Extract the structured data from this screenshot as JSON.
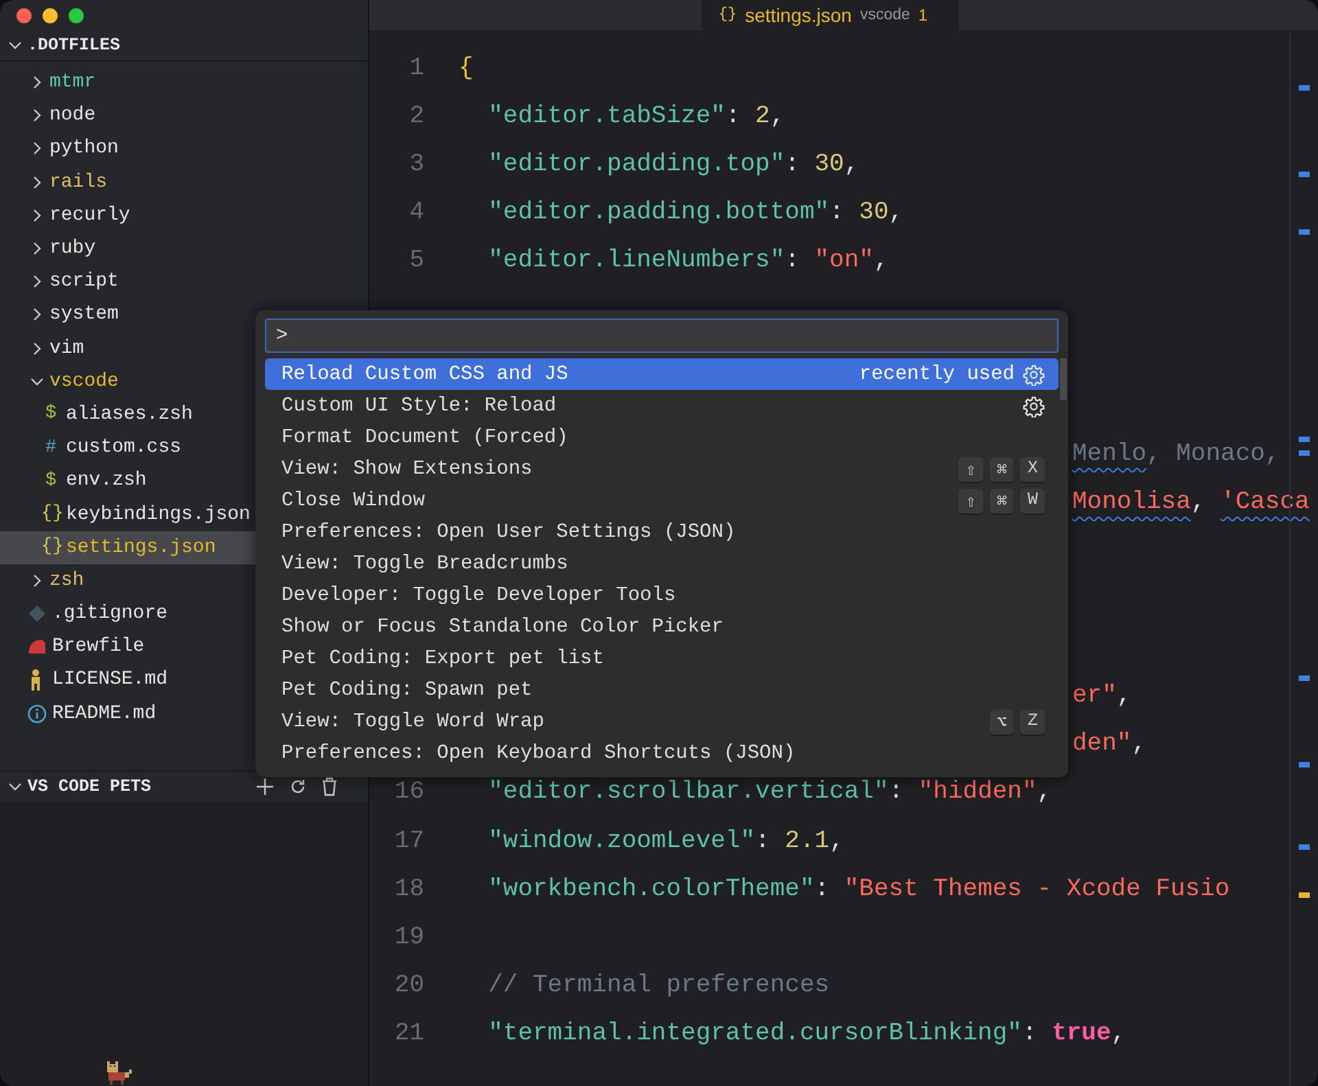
{
  "explorer": {
    "title": ".DOTFILES",
    "expanded": true,
    "items": [
      {
        "label": "mtmr",
        "kind": "folder",
        "expanded": false,
        "color": "#5fcfa2",
        "selected": false
      },
      {
        "label": "node",
        "kind": "folder",
        "expanded": false,
        "color": "#e6e6e6",
        "selected": false
      },
      {
        "label": "python",
        "kind": "folder",
        "expanded": false,
        "color": "#e6e6e6",
        "selected": false
      },
      {
        "label": "rails",
        "kind": "folder",
        "expanded": false,
        "color": "#e2bb6c",
        "selected": false
      },
      {
        "label": "recurly",
        "kind": "folder",
        "expanded": false,
        "color": "#e6e6e6",
        "selected": false
      },
      {
        "label": "ruby",
        "kind": "folder",
        "expanded": false,
        "color": "#e6e6e6",
        "selected": false
      },
      {
        "label": "script",
        "kind": "folder",
        "expanded": false,
        "color": "#e6e6e6",
        "selected": false
      },
      {
        "label": "system",
        "kind": "folder",
        "expanded": false,
        "color": "#e6e6e6",
        "selected": false
      },
      {
        "label": "vim",
        "kind": "folder",
        "expanded": false,
        "color": "#e6e6e6",
        "selected": false
      },
      {
        "label": "vscode",
        "kind": "folder",
        "expanded": true,
        "color": "#e5b92c",
        "selected": false,
        "children": [
          {
            "label": "aliases.zsh",
            "kind": "shell",
            "glyph": "$",
            "color": "#e6e6e6",
            "selected": false
          },
          {
            "label": "custom.css",
            "kind": "css",
            "glyph": "#",
            "color": "#e6e6e6",
            "selected": false
          },
          {
            "label": "env.zsh",
            "kind": "shell",
            "glyph": "$",
            "color": "#e6e6e6",
            "selected": false
          },
          {
            "label": "keybindings.json",
            "kind": "json",
            "glyph": "{}",
            "color": "#e6e6e6",
            "selected": false
          },
          {
            "label": "settings.json",
            "kind": "json",
            "glyph": "{}",
            "color": "#e5b92c",
            "selected": true
          }
        ]
      },
      {
        "label": "zsh",
        "kind": "folder",
        "expanded": false,
        "color": "#e2bb6c",
        "selected": false
      },
      {
        "label": ".gitignore",
        "kind": "diamond",
        "color": "#e6e6e6",
        "selected": false
      },
      {
        "label": "Brewfile",
        "kind": "blob",
        "color": "#e6e6e6",
        "selected": false
      },
      {
        "label": "LICENSE.md",
        "kind": "figure",
        "color": "#e6e6e6",
        "selected": false
      },
      {
        "label": "README.md",
        "kind": "info",
        "color": "#e6e6e6",
        "selected": false
      }
    ]
  },
  "pets_panel": {
    "title": "VS CODE PETS",
    "expanded": true
  },
  "tab": {
    "icon": "{}",
    "label": "settings.json",
    "folder": "vscode",
    "problems": "1"
  },
  "editor_lines": [
    {
      "kind": "line",
      "number": "1",
      "tokens": [
        {
          "text": "{",
          "kind": "brace"
        }
      ]
    },
    {
      "kind": "line",
      "number": "2",
      "tokens": [
        {
          "text": "  \"editor.tabSize\"",
          "kind": "key"
        },
        {
          "text": ": ",
          "kind": "punct"
        },
        {
          "text": "2",
          "kind": "number"
        },
        {
          "text": ",",
          "kind": "punct"
        }
      ]
    },
    {
      "kind": "line",
      "number": "3",
      "tokens": [
        {
          "text": "  \"editor.padding.top\"",
          "kind": "key"
        },
        {
          "text": ": ",
          "kind": "punct"
        },
        {
          "text": "30",
          "kind": "number"
        },
        {
          "text": ",",
          "kind": "punct"
        }
      ]
    },
    {
      "kind": "line",
      "number": "4",
      "tokens": [
        {
          "text": "  \"editor.padding.bottom\"",
          "kind": "key"
        },
        {
          "text": ": ",
          "kind": "punct"
        },
        {
          "text": "30",
          "kind": "number"
        },
        {
          "text": ",",
          "kind": "punct"
        }
      ]
    },
    {
      "kind": "line",
      "number": "5",
      "tokens": [
        {
          "text": "  \"editor.lineNumbers\"",
          "kind": "key"
        },
        {
          "text": ": ",
          "kind": "punct"
        },
        {
          "text": "\"on\"",
          "kind": "string"
        },
        {
          "text": ",",
          "kind": "punct"
        }
      ]
    },
    {
      "kind": "covered"
    },
    {
      "kind": "covered"
    },
    {
      "kind": "covered"
    },
    {
      "kind": "tail",
      "tokens": [
        {
          "text": "Menlo",
          "kind": "comment",
          "squiggle": true
        },
        {
          "text": ", Monaco,",
          "kind": "comment"
        }
      ]
    },
    {
      "kind": "tail",
      "tokens": [
        {
          "text": "Monolisa",
          "kind": "string",
          "squiggle": true
        },
        {
          "text": ", ",
          "kind": "punct"
        },
        {
          "text": "'Casca",
          "kind": "string",
          "squiggle": true
        }
      ]
    },
    {
      "kind": "covered"
    },
    {
      "kind": "covered"
    },
    {
      "kind": "covered"
    },
    {
      "kind": "tail",
      "tokens": [
        {
          "text": "er\"",
          "kind": "string"
        },
        {
          "text": ",",
          "kind": "punct"
        }
      ]
    },
    {
      "kind": "tail",
      "tokens": [
        {
          "text": "den\"",
          "kind": "string"
        },
        {
          "text": ",",
          "kind": "punct"
        }
      ]
    },
    {
      "kind": "line",
      "number": "16",
      "tokens": [
        {
          "text": "  \"editor.scrollbar.vertical\"",
          "kind": "key"
        },
        {
          "text": ": ",
          "kind": "punct"
        },
        {
          "text": "\"hidden\"",
          "kind": "string"
        },
        {
          "text": ",",
          "kind": "punct"
        }
      ]
    },
    {
      "kind": "line",
      "number": "17",
      "tokens": [
        {
          "text": "  \"window.zoomLevel\"",
          "kind": "key"
        },
        {
          "text": ": ",
          "kind": "punct"
        },
        {
          "text": "2.1",
          "kind": "number"
        },
        {
          "text": ",",
          "kind": "punct"
        }
      ]
    },
    {
      "kind": "line",
      "number": "18",
      "tokens": [
        {
          "text": "  \"workbench.colorTheme\"",
          "kind": "key"
        },
        {
          "text": ": ",
          "kind": "punct"
        },
        {
          "text": "\"Best Themes - Xcode Fusio",
          "kind": "string"
        }
      ]
    },
    {
      "kind": "line",
      "number": "19"
    },
    {
      "kind": "line",
      "number": "20",
      "tokens": [
        {
          "text": "  // Terminal preferences",
          "kind": "comment"
        }
      ]
    },
    {
      "kind": "line",
      "number": "21",
      "tokens": [
        {
          "text": "  \"terminal.integrated.cursorBlinking\"",
          "kind": "key"
        },
        {
          "text": ": ",
          "kind": "punct"
        },
        {
          "text": "true",
          "kind": "bool"
        },
        {
          "text": ",",
          "kind": "punct"
        }
      ]
    }
  ],
  "command_palette": {
    "value": ">",
    "items": [
      {
        "label": "Reload Custom CSS and JS",
        "selected": true,
        "detail": "recently used",
        "gear": true
      },
      {
        "label": "Custom UI Style: Reload",
        "selected": false,
        "gear": true
      },
      {
        "label": "Format Document (Forced)",
        "selected": false,
        "gear": false
      },
      {
        "label": "View: Show Extensions",
        "selected": false,
        "gear": false,
        "keys": [
          "⇧",
          "⌘",
          "X"
        ]
      },
      {
        "label": "Close Window",
        "selected": false,
        "gear": false,
        "keys": [
          "⇧",
          "⌘",
          "W"
        ]
      },
      {
        "label": "Preferences: Open User Settings (JSON)",
        "selected": false,
        "gear": false
      },
      {
        "label": "View: Toggle Breadcrumbs",
        "selected": false,
        "gear": false
      },
      {
        "label": "Developer: Toggle Developer Tools",
        "selected": false,
        "gear": false
      },
      {
        "label": "Show or Focus Standalone Color Picker",
        "selected": false,
        "gear": false
      },
      {
        "label": "Pet Coding: Export pet list",
        "selected": false,
        "gear": false
      },
      {
        "label": "Pet Coding: Spawn pet",
        "selected": false,
        "gear": false
      },
      {
        "label": "View: Toggle Word Wrap",
        "selected": false,
        "gear": false,
        "keys": [
          "⌥",
          "Z"
        ]
      },
      {
        "label": "Preferences: Open Keyboard Shortcuts (JSON)",
        "selected": false,
        "gear": false
      }
    ]
  }
}
